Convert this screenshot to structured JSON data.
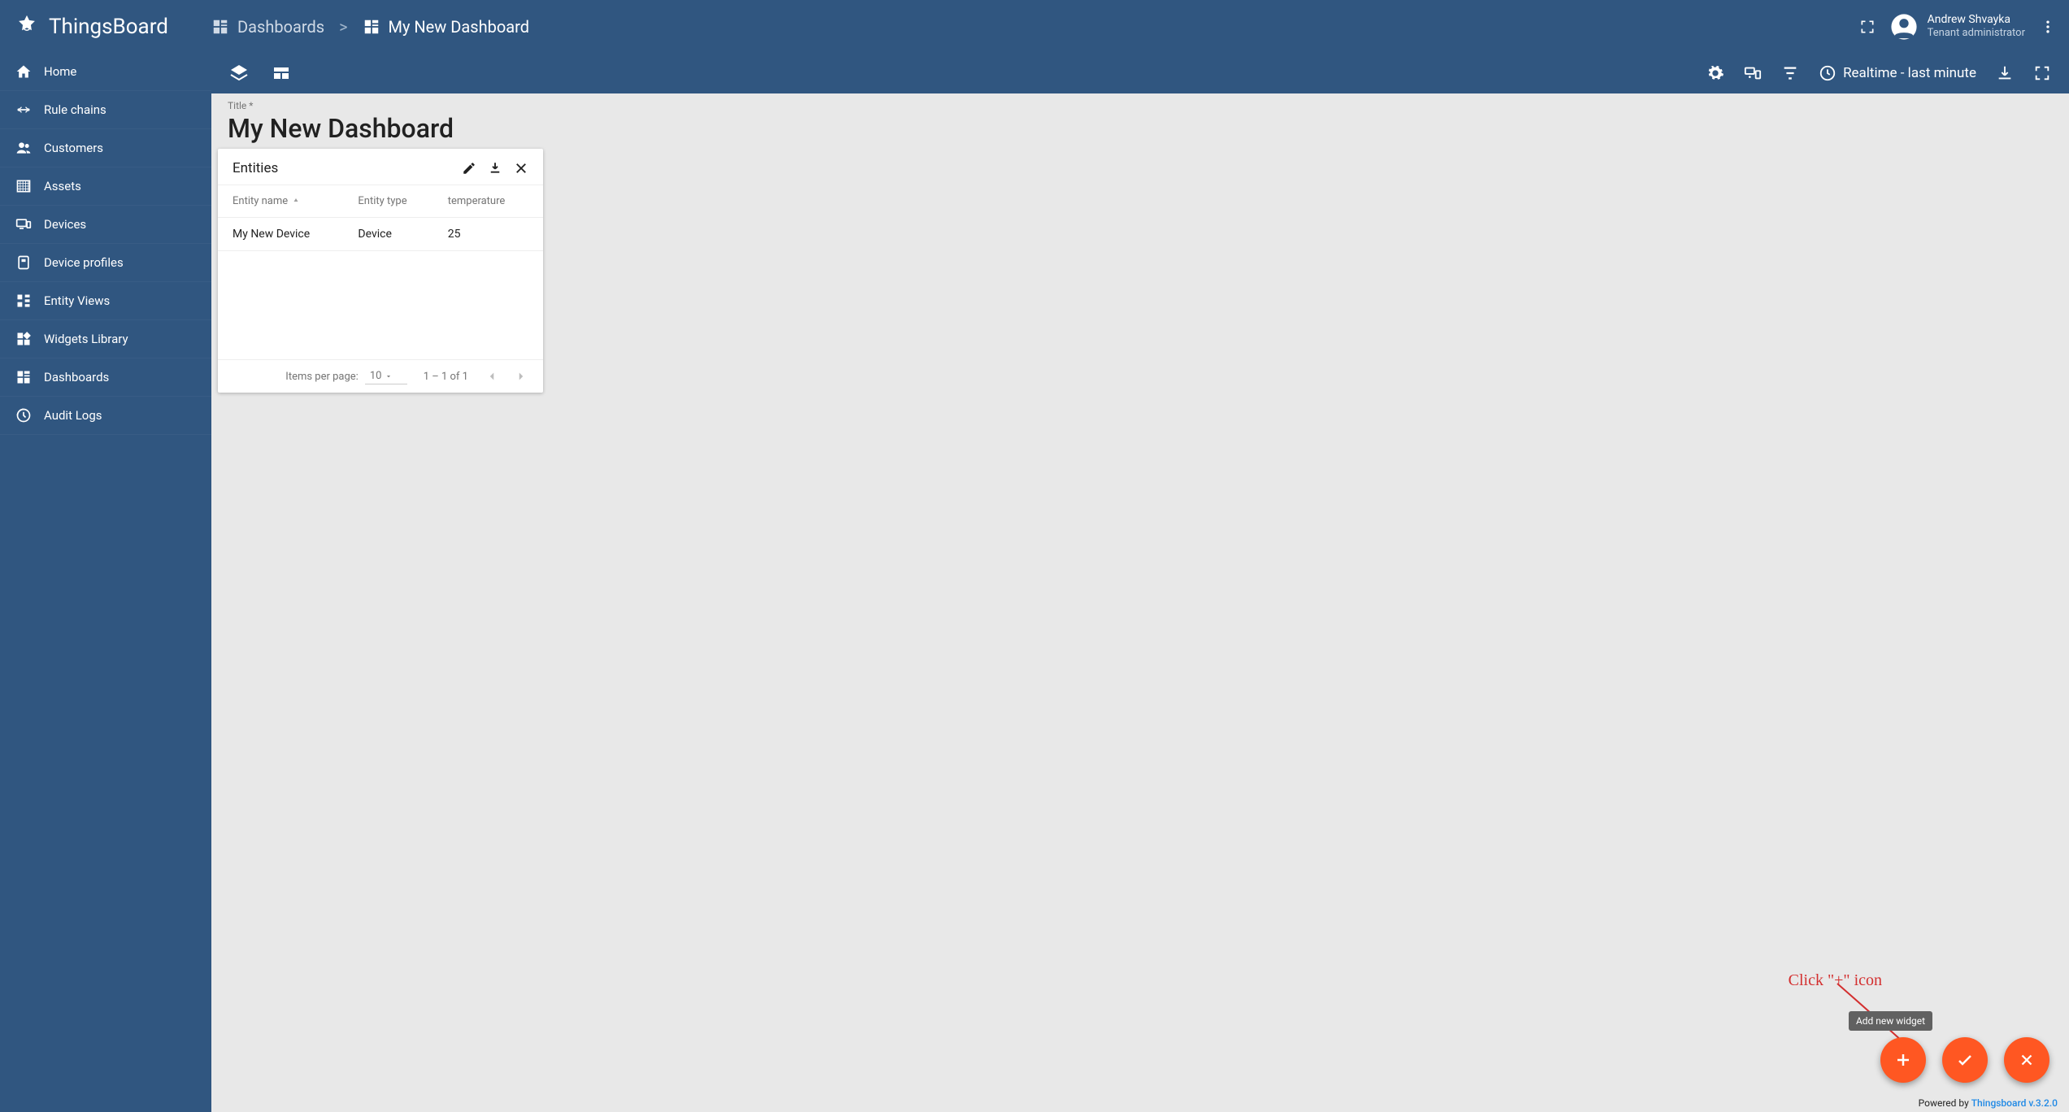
{
  "app": {
    "name": "ThingsBoard"
  },
  "breadcrumb": {
    "root": "Dashboards",
    "sep": ">",
    "current": "My New Dashboard"
  },
  "user": {
    "name": "Andrew Shvayka",
    "role": "Tenant administrator"
  },
  "sidebar": {
    "items": [
      {
        "label": "Home",
        "icon": "home"
      },
      {
        "label": "Rule chains",
        "icon": "rule"
      },
      {
        "label": "Customers",
        "icon": "customers"
      },
      {
        "label": "Assets",
        "icon": "assets"
      },
      {
        "label": "Devices",
        "icon": "devices"
      },
      {
        "label": "Device profiles",
        "icon": "profile"
      },
      {
        "label": "Entity Views",
        "icon": "entity"
      },
      {
        "label": "Widgets Library",
        "icon": "widgets"
      },
      {
        "label": "Dashboards",
        "icon": "dashboards"
      },
      {
        "label": "Audit Logs",
        "icon": "audit"
      }
    ]
  },
  "toolbar": {
    "timewindow": "Realtime - last minute"
  },
  "title": {
    "label": "Title *",
    "value": "My New Dashboard"
  },
  "widget": {
    "title": "Entities",
    "columns": [
      "Entity name",
      "Entity type",
      "temperature"
    ],
    "rows": [
      {
        "name": "My New Device",
        "type": "Device",
        "temperature": "25"
      }
    ],
    "pager": {
      "label": "Items per page:",
      "size": "10",
      "range": "1 – 1 of 1"
    }
  },
  "tooltip": "Add new widget",
  "annotation": "Click \"+\" icon",
  "footer": {
    "prefix": "Powered by ",
    "link": "Thingsboard v.3.2.0"
  }
}
